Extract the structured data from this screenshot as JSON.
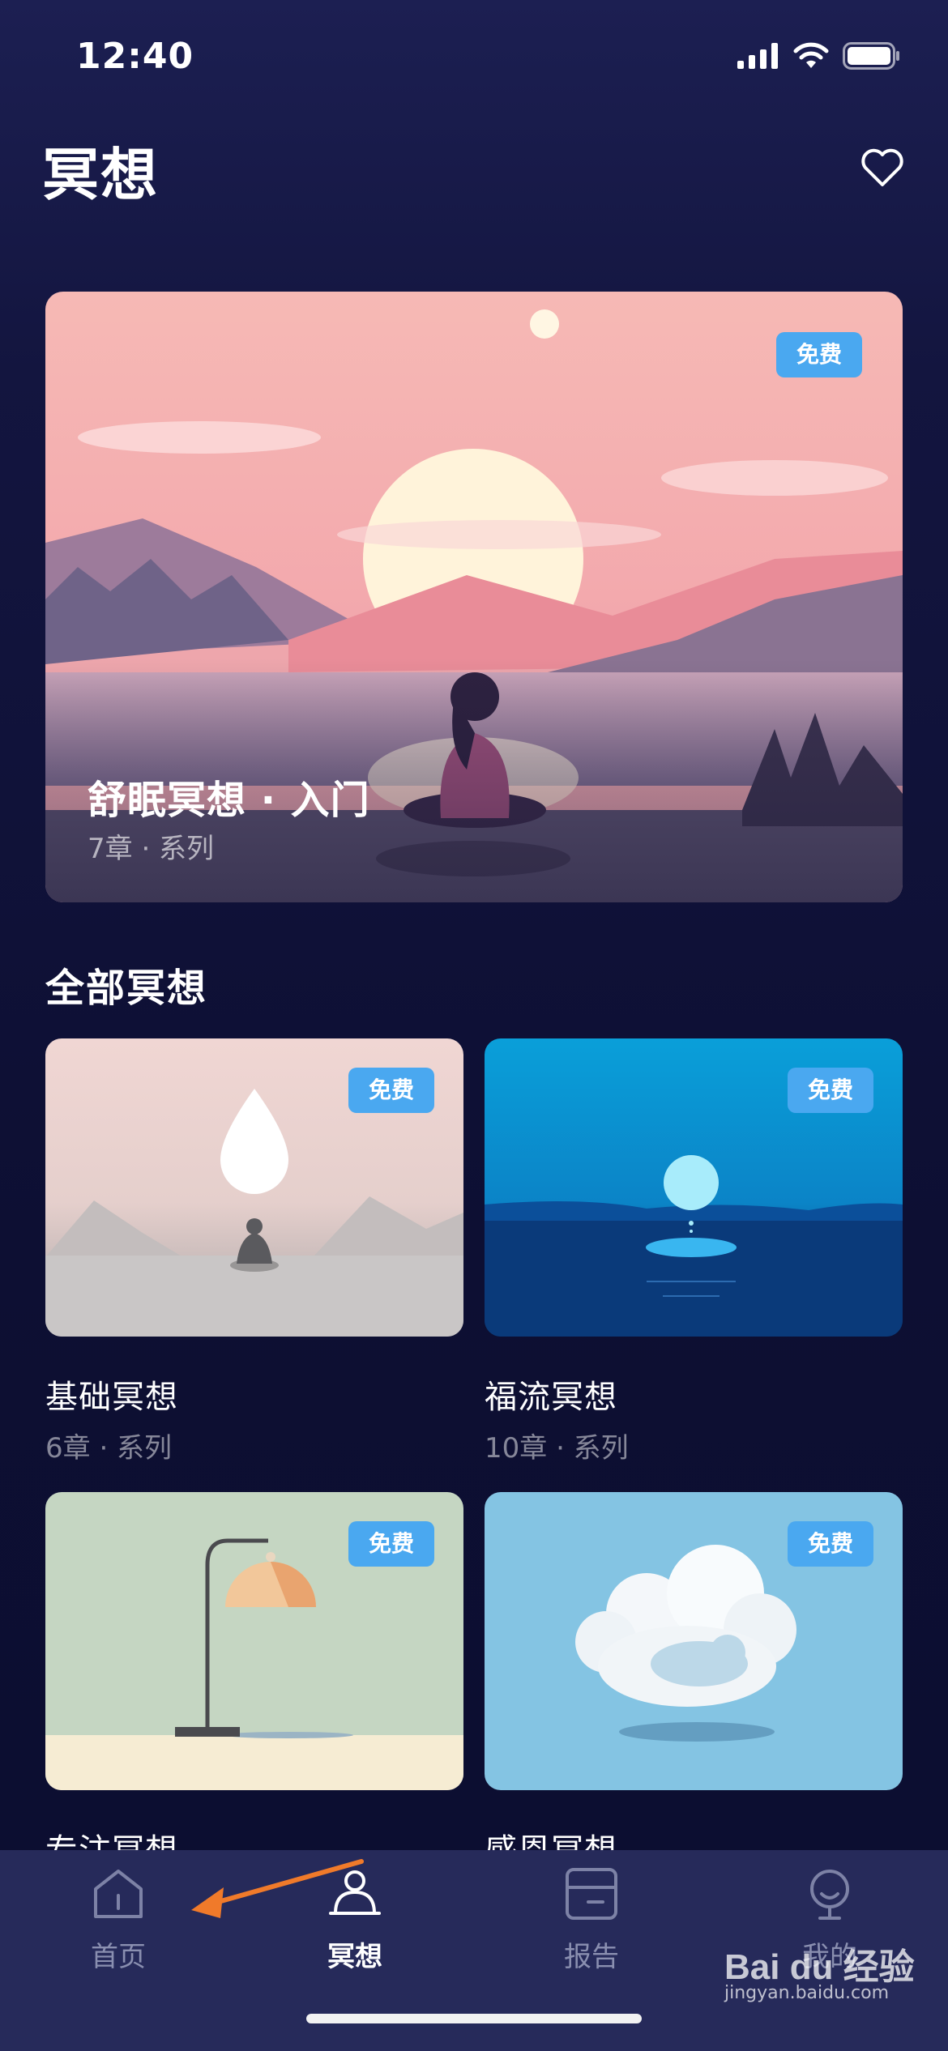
{
  "status": {
    "time": "12:40"
  },
  "header": {
    "title": "冥想",
    "favorite_icon": "heart-outline-icon"
  },
  "hero": {
    "badge": "免费",
    "title": "舒眠冥想 · 入门",
    "subtitle": "7章 · 系列"
  },
  "section": {
    "title": "全部冥想"
  },
  "cards": [
    {
      "badge": "免费",
      "title": "基础冥想",
      "subtitle": "6章 · 系列"
    },
    {
      "badge": "免费",
      "title": "福流冥想",
      "subtitle": "10章 · 系列"
    },
    {
      "badge": "免费",
      "title": "专注冥想",
      "subtitle": ""
    },
    {
      "badge": "免费",
      "title": "感恩冥想",
      "subtitle": ""
    }
  ],
  "tabs": [
    {
      "label": "首页",
      "icon": "home-icon",
      "active": false
    },
    {
      "label": "冥想",
      "icon": "meditation-icon",
      "active": true
    },
    {
      "label": "报告",
      "icon": "report-icon",
      "active": false
    },
    {
      "label": "我的",
      "icon": "profile-icon",
      "active": false
    }
  ],
  "watermark": {
    "brand": "Bai du 经验",
    "url": "jingyan.baidu.com"
  },
  "colors": {
    "accent": "#4aa8f0",
    "background": "#0d0f33",
    "tabbar": "#262a5a",
    "annotation_arrow": "#f07a2a"
  }
}
